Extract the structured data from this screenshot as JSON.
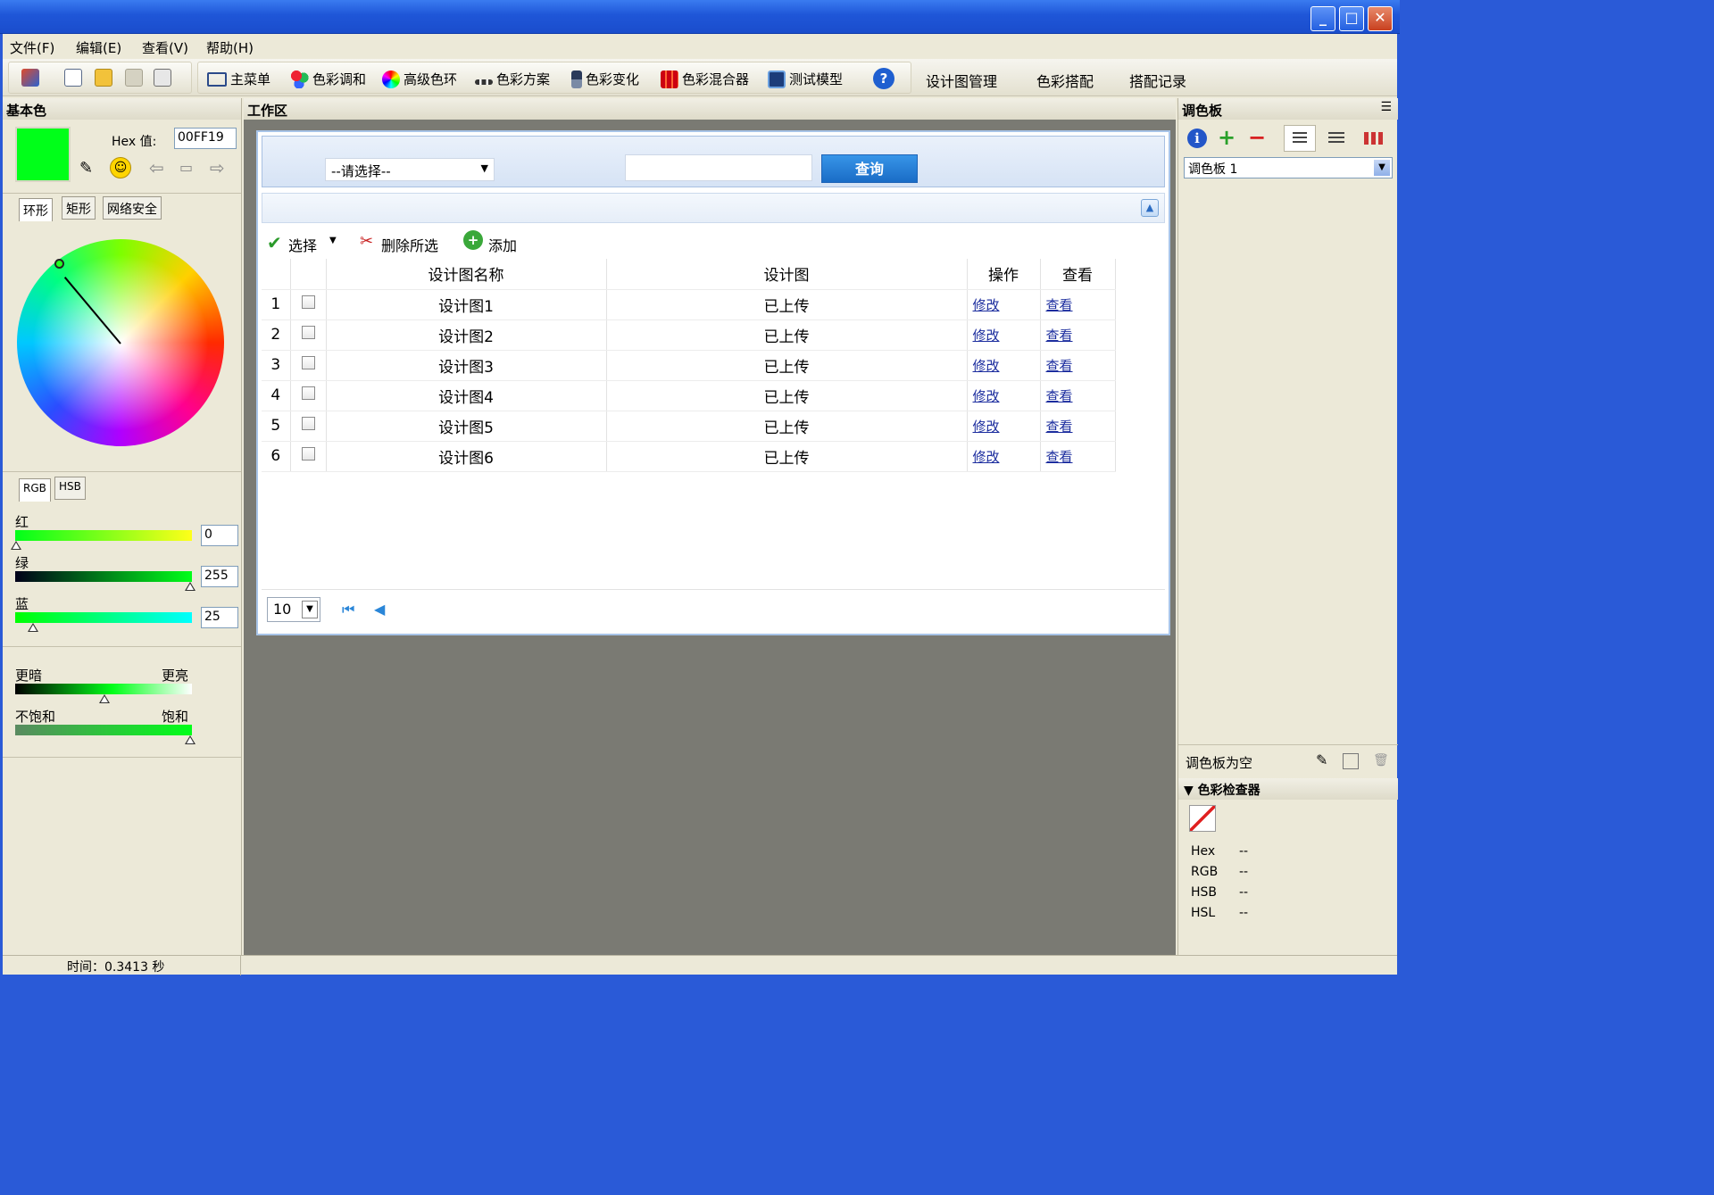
{
  "window": {
    "minimize": "_",
    "maximize": "□",
    "close": "✕"
  },
  "menu": [
    "文件(F)",
    "编辑(E)",
    "查看(V)",
    "帮助(H)"
  ],
  "toolbar": {
    "main_menu": "主菜单",
    "color_harmony": "色彩调和",
    "advanced_wheel": "高级色环",
    "color_scheme": "色彩方案",
    "color_variation": "色彩变化",
    "color_mixer": "色彩混合器",
    "test_model": "测试模型",
    "help": "?",
    "link_design_mgmt": "设计图管理",
    "link_color_match": "色彩搭配",
    "link_match_record": "搭配记录"
  },
  "left_panel": {
    "title": "基本色",
    "hex_label": "Hex 值:",
    "hex_value": "00FF19",
    "swatch_color": "#00ff19",
    "tabs": [
      "环形",
      "矩形",
      "网络安全"
    ],
    "active_tab": "环形",
    "model_tabs": [
      "RGB",
      "HSB"
    ],
    "red_label": "红",
    "green_label": "绿",
    "blue_label": "蓝",
    "red": "0",
    "green": "255",
    "blue": "25",
    "darker": "更暗",
    "brighter": "更亮",
    "unsaturated": "不饱和",
    "saturated": "饱和"
  },
  "work_area": {
    "title": "工作区",
    "select_placeholder": "--请选择--",
    "query_button": "查询",
    "toolbar_select": "选择",
    "toolbar_delete": "删除所选",
    "toolbar_add": "添加",
    "columns": [
      "设计图名称",
      "设计图",
      "操作",
      "查看"
    ],
    "rows": [
      {
        "num": "1",
        "name": "设计图1",
        "status": "已上传",
        "op": "修改",
        "view": "查看"
      },
      {
        "num": "2",
        "name": "设计图2",
        "status": "已上传",
        "op": "修改",
        "view": "查看"
      },
      {
        "num": "3",
        "name": "设计图3",
        "status": "已上传",
        "op": "修改",
        "view": "查看"
      },
      {
        "num": "4",
        "name": "设计图4",
        "status": "已上传",
        "op": "修改",
        "view": "查看"
      },
      {
        "num": "5",
        "name": "设计图5",
        "status": "已上传",
        "op": "修改",
        "view": "查看"
      },
      {
        "num": "6",
        "name": "设计图6",
        "status": "已上传",
        "op": "修改",
        "view": "查看"
      }
    ],
    "page_size": "10"
  },
  "right_panel": {
    "title": "调色板",
    "palette_select": "调色板 1",
    "empty_text": "调色板为空",
    "checker_title": "色彩检查器",
    "checker": [
      {
        "k": "Hex",
        "v": "--"
      },
      {
        "k": "RGB",
        "v": "--"
      },
      {
        "k": "HSB",
        "v": "--"
      },
      {
        "k": "HSL",
        "v": "--"
      }
    ]
  },
  "status": {
    "time": "时间：0.3413 秒"
  }
}
